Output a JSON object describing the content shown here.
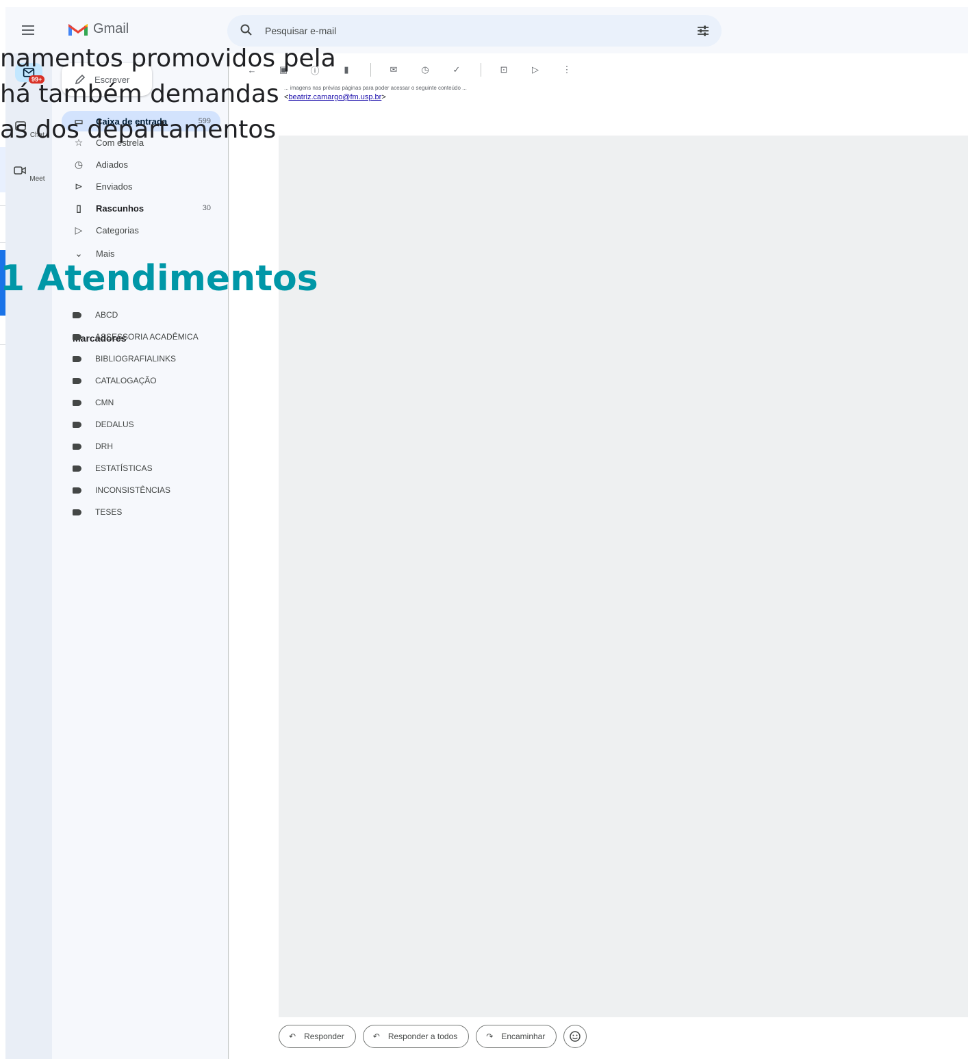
{
  "app": {
    "name": "Gmail"
  },
  "search": {
    "placeholder": "Pesquisar e-mail"
  },
  "rail": {
    "badge": "99+",
    "chat_label": "Chat",
    "meet_label": "Meet"
  },
  "sidebar": {
    "compose_label": "Escrever",
    "items": [
      {
        "label": "Caixa de entrada",
        "count": "599"
      },
      {
        "label": "Com estrela",
        "count": ""
      },
      {
        "label": "Adiados",
        "count": ""
      },
      {
        "label": "Enviados",
        "count": ""
      },
      {
        "label": "Rascunhos",
        "count": "30"
      },
      {
        "label": "Categorias",
        "count": ""
      },
      {
        "label": "Mais",
        "count": ""
      }
    ],
    "labels_heading": "Marcadores",
    "labels": [
      "ABCD",
      "ASSESSORIA ACADÊMICA",
      "BIBLIOGRAFIALINKS",
      "CATALOGAÇÃO",
      "CMN",
      "DEDALUS",
      "DRH",
      "ESTATÍSTICAS",
      "INCONSISTÊNCIAS",
      "TESES"
    ]
  },
  "message": {
    "body_line": "... imagens nas prévias páginas para poder acessar o seguinte conteúdo ...",
    "email_prefix": "<",
    "email": "beatriz.camargo@fm.usp.br",
    "email_suffix": ">"
  },
  "reply_bar": {
    "reply": "Responder",
    "reply_all": "Responder a todos",
    "forward": "Encaminhar"
  },
  "overlay": {
    "line1": "namentos promovidos pela",
    "line2": "há também demandas",
    "line3": "as dos departamentos",
    "title": "1 Atendimentos"
  },
  "colors": {
    "accent": "#0097a7",
    "badge": "#d93025",
    "link": "#1a0dab"
  }
}
